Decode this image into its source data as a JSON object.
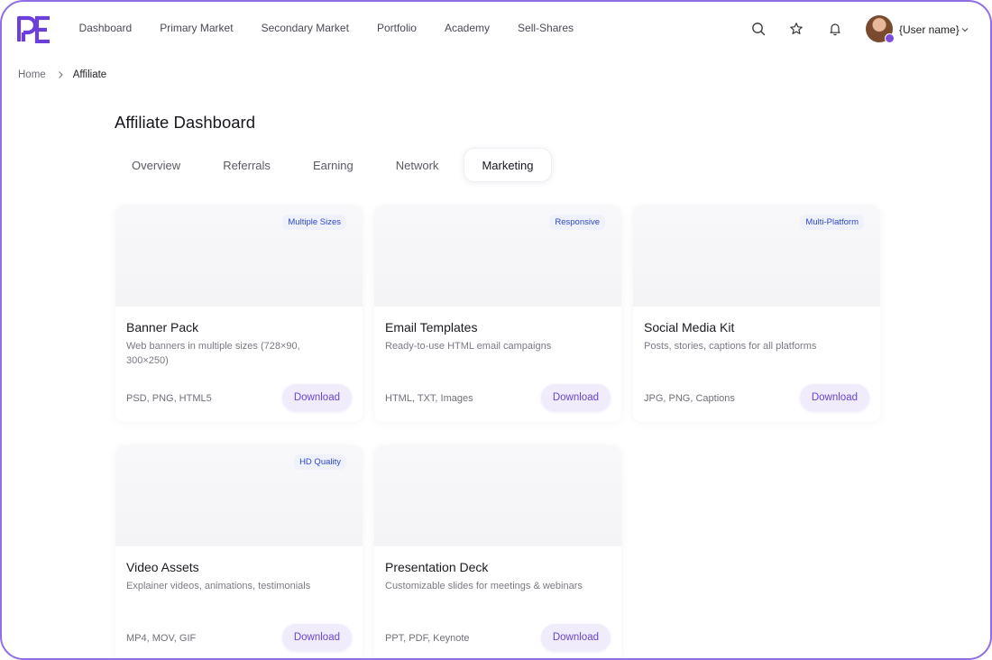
{
  "nav": {
    "items": [
      {
        "label": "Dashboard"
      },
      {
        "label": "Primary Market"
      },
      {
        "label": "Secondary Market"
      },
      {
        "label": "Portfolio"
      },
      {
        "label": "Academy"
      },
      {
        "label": "Sell-Shares"
      }
    ]
  },
  "user": {
    "name": "{User name}"
  },
  "breadcrumb": {
    "home": "Home",
    "current": "Affiliate"
  },
  "page": {
    "title": "Affiliate Dashboard"
  },
  "tabs": [
    {
      "label": "Overview"
    },
    {
      "label": "Referrals"
    },
    {
      "label": "Earning"
    },
    {
      "label": "Network"
    },
    {
      "label": "Marketing",
      "active": true
    }
  ],
  "cards": [
    {
      "badge": "Multiple Sizes",
      "title": "Banner Pack",
      "description": "Web banners in multiple sizes (728×90, 300×250)",
      "formats": "PSD, PNG, HTML5",
      "button": "Download"
    },
    {
      "badge": "Responsive",
      "title": "Email Templates",
      "description": "Ready-to-use HTML email campaigns",
      "formats": "HTML, TXT, Images",
      "button": "Download"
    },
    {
      "badge": "Multi-Platform",
      "title": "Social Media Kit",
      "description": "Posts, stories, captions for all platforms",
      "formats": "JPG, PNG, Captions",
      "button": "Download"
    },
    {
      "badge": "HD Quality",
      "title": "Video Assets",
      "description": "Explainer videos, animations, testimonials",
      "formats": "MP4, MOV, GIF",
      "button": "Download"
    },
    {
      "badge": "",
      "title": "Presentation Deck",
      "description": "Customizable slides for meetings & webinars",
      "formats": "PPT, PDF, Keynote",
      "button": "Download"
    }
  ],
  "colors": {
    "brand": "#6b3fd9",
    "frame": "#8f6ee6",
    "badge_text": "#2c46c9",
    "button_bg": "#f0ecfb",
    "button_text": "#6a44d0"
  }
}
